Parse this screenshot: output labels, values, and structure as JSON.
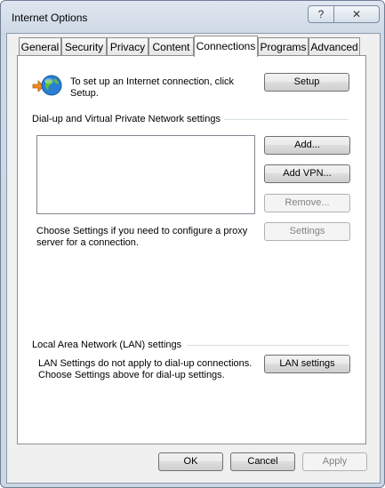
{
  "window": {
    "title": "Internet Options",
    "help_glyph": "?",
    "close_glyph": "✕"
  },
  "tabs": [
    {
      "label": "General"
    },
    {
      "label": "Security"
    },
    {
      "label": "Privacy"
    },
    {
      "label": "Content"
    },
    {
      "label": "Connections",
      "selected": true
    },
    {
      "label": "Programs"
    },
    {
      "label": "Advanced"
    }
  ],
  "setup": {
    "text_line1": "To set up an Internet connection, click",
    "text_line2": "Setup.",
    "button_label": "Setup"
  },
  "dialup": {
    "heading": "Dial-up and Virtual Private Network settings",
    "add_label": "Add...",
    "add_vpn_label": "Add VPN...",
    "remove_label": "Remove...",
    "settings_label": "Settings",
    "proxy_line1": "Choose Settings if you need to configure a proxy",
    "proxy_line2": "server for a connection."
  },
  "lan": {
    "heading": "Local Area Network (LAN) settings",
    "text_line1": "LAN Settings do not apply to dial-up connections.",
    "text_line2": "Choose Settings above for dial-up settings.",
    "button_label": "LAN settings"
  },
  "footer": {
    "ok_label": "OK",
    "cancel_label": "Cancel",
    "apply_label": "Apply"
  },
  "colors": {
    "accent_globe": "#2a7fd4",
    "arrow": "#f08a1e"
  }
}
